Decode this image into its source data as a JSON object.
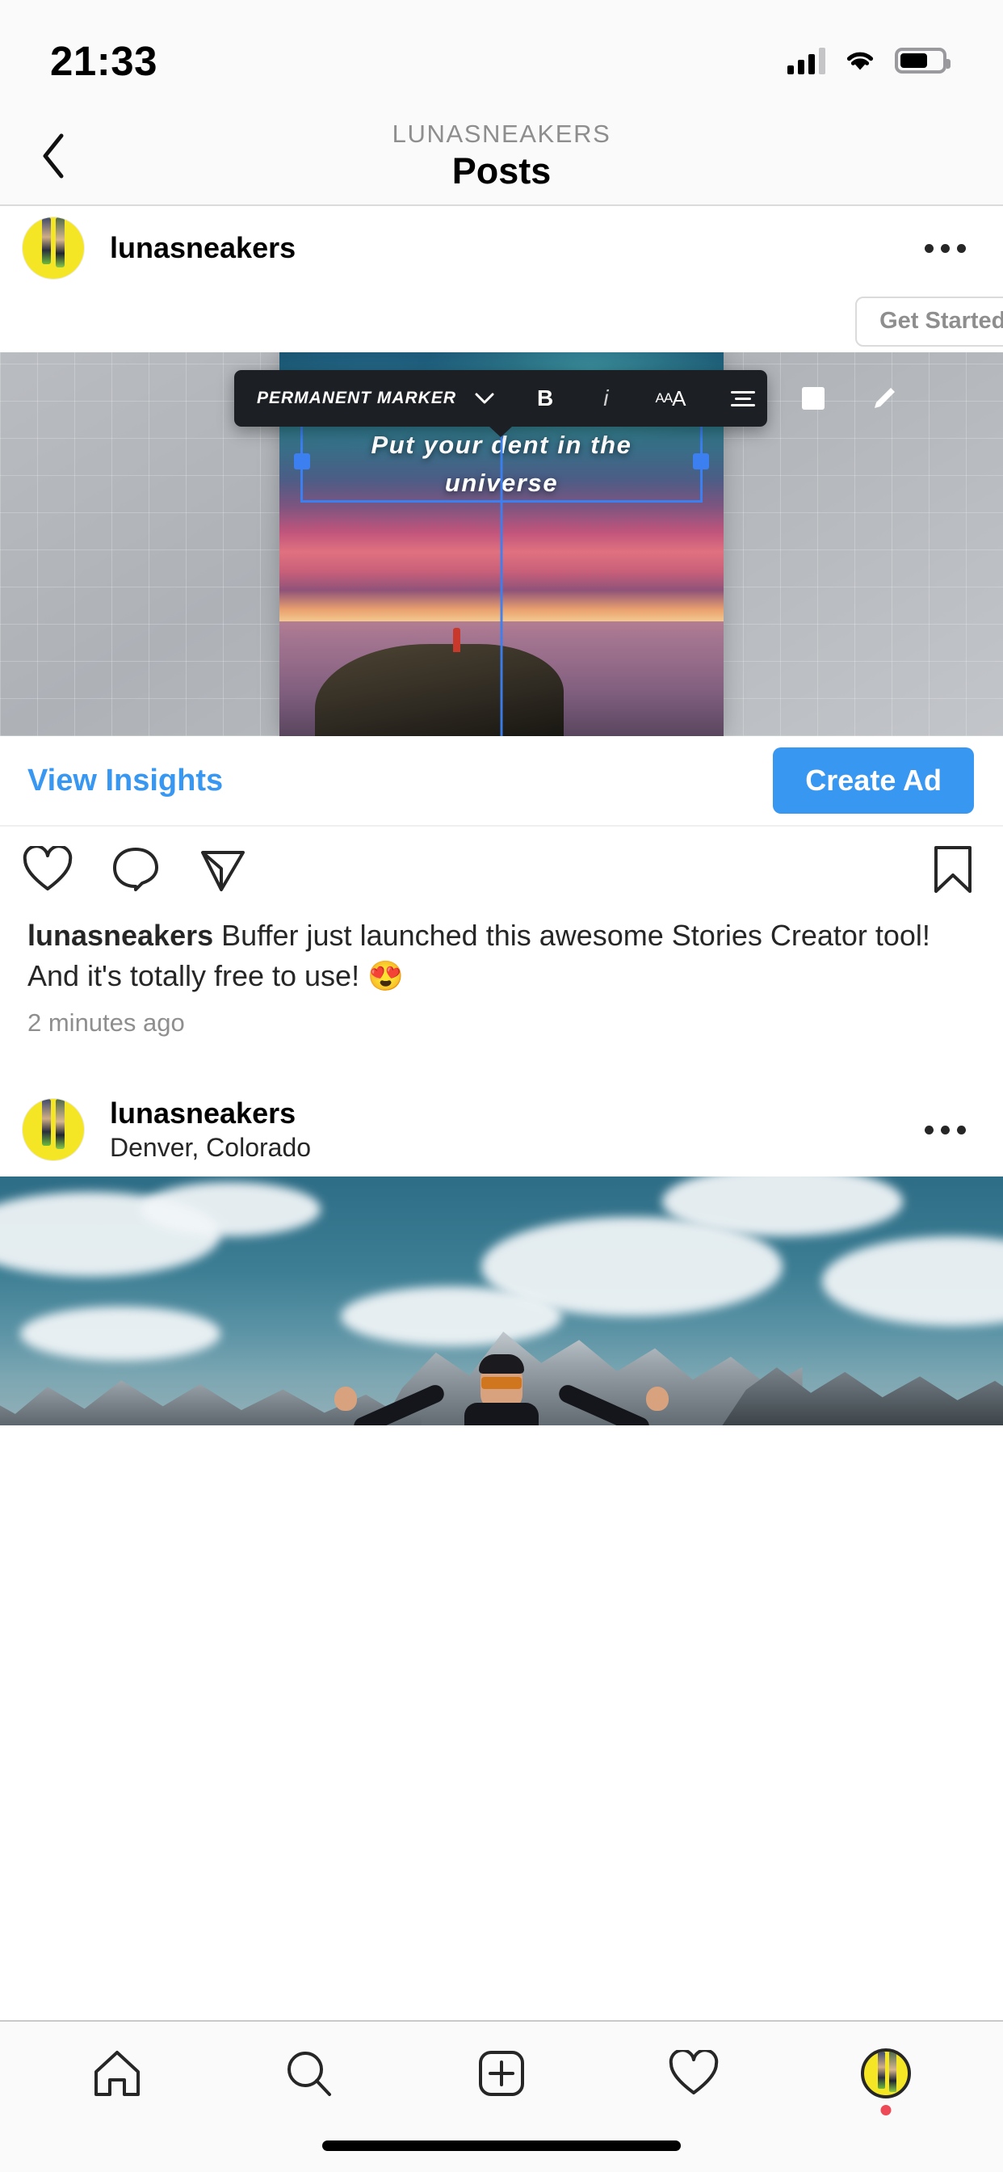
{
  "status_bar": {
    "time": "21:33",
    "signal_icon": "signal-bars-icon",
    "wifi_icon": "wifi-icon",
    "battery_icon": "battery-icon",
    "battery_level_pct": 65
  },
  "nav": {
    "back_icon": "chevron-left-icon",
    "subtitle": "LUNASNEAKERS",
    "title": "Posts"
  },
  "posts": [
    {
      "username": "lunasneakers",
      "location": "",
      "avatar_icon": "profile-avatar-icon",
      "more_icon": "more-options-icon",
      "promo_button_label": "Get Started With",
      "media": {
        "type": "story-editor-screenshot",
        "toolbar": {
          "font_name": "Permanent Marker",
          "chevron_icon": "chevron-down-icon",
          "bold_label": "B",
          "italic_label": "i",
          "font_size_label": "AaA",
          "align_icon": "text-align-icon",
          "color_icon": "color-swatch-icon",
          "pen_icon": "marker-pen-icon"
        },
        "overlay_text_line1": "Put your dent in the",
        "overlay_text_line2": "universe"
      },
      "view_insights_label": "View Insights",
      "create_ad_label": "Create Ad",
      "actions": {
        "like_icon": "heart-icon",
        "comment_icon": "comment-icon",
        "share_icon": "share-paper-plane-icon",
        "save_icon": "bookmark-icon"
      },
      "caption_author": "lunasneakers",
      "caption_text": " Buffer just launched this awesome Stories Creator tool! And it's totally free to use! 😍",
      "timestamp": "2 minutes ago"
    },
    {
      "username": "lunasneakers",
      "location": "Denver, Colorado",
      "avatar_icon": "profile-avatar-icon",
      "more_icon": "more-options-icon",
      "media": {
        "type": "photo-mountains-sky"
      }
    }
  ],
  "tab_bar": {
    "items": [
      {
        "name": "home",
        "icon": "home-icon"
      },
      {
        "name": "search",
        "icon": "search-icon"
      },
      {
        "name": "add-post",
        "icon": "plus-square-icon"
      },
      {
        "name": "activity",
        "icon": "heart-icon"
      },
      {
        "name": "profile",
        "icon": "profile-avatar-icon",
        "has_badge": true
      }
    ],
    "home_indicator": "home-indicator-bar"
  },
  "colors": {
    "accent_blue": "#3897f0",
    "avatar_yellow": "#f5e625",
    "badge_red": "#ed4956",
    "text_primary": "#262626",
    "text_secondary": "#8e8e8e",
    "bg_chrome": "#fafafa"
  }
}
